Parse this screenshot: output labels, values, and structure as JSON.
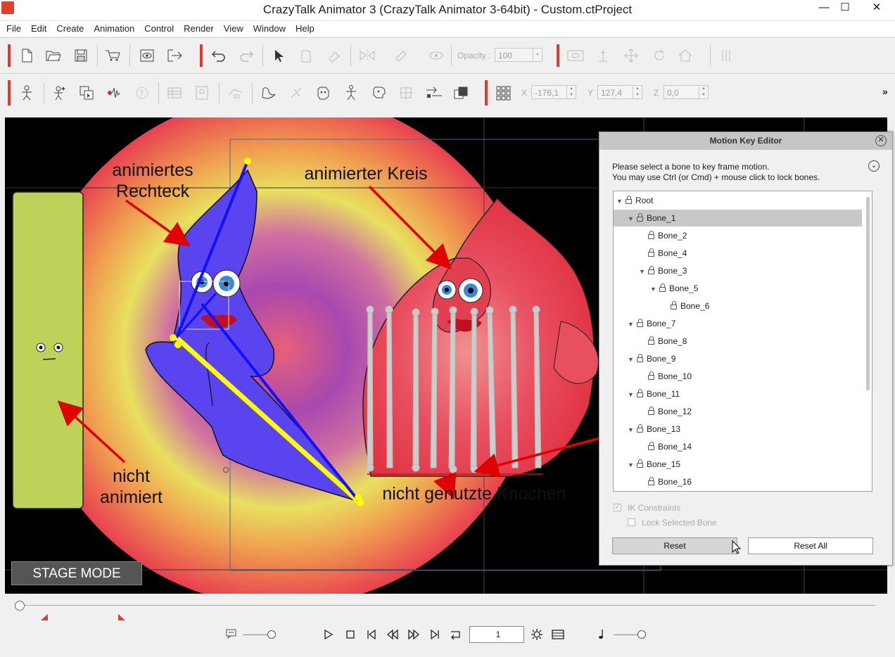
{
  "window": {
    "title": "CrazyTalk Animator 3  (CrazyTalk Animator 3-64bit) - Custom.ctProject",
    "minimize": "—",
    "maximize": "☐",
    "close": "✕"
  },
  "menu": [
    "File",
    "Edit",
    "Create",
    "Animation",
    "Control",
    "Render",
    "View",
    "Window",
    "Help"
  ],
  "toolbar1": {
    "opacity_label": "Opacity :",
    "opacity_value": "100"
  },
  "toolbar2": {
    "x_label": "X",
    "x_value": "-176,1",
    "y_label": "Y",
    "y_value": "127,4",
    "z_label": "Z",
    "z_value": "0,0",
    "more": "»"
  },
  "viewport": {
    "annotations": {
      "animiertes_rechteck": "animiertes\nRechteck",
      "animierter_kreis": "animierter Kreis",
      "nicht_animiert": "nicht\nanimiert",
      "nicht_genutzte_knochen": "nicht genutzte Knochen"
    },
    "stage_mode": "STAGE MODE"
  },
  "motion_key_editor": {
    "title": "Motion Key Editor",
    "instructions_line1": "Please select a bone to key frame motion.",
    "instructions_line2": "You may use Ctrl (or Cmd) + mouse click to lock bones.",
    "tree": [
      {
        "label": "Root",
        "depth": 0,
        "expanded": true,
        "selected": false
      },
      {
        "label": "Bone_1",
        "depth": 1,
        "expanded": true,
        "selected": true
      },
      {
        "label": "Bone_2",
        "depth": 2,
        "expanded": null,
        "selected": false
      },
      {
        "label": "Bone_4",
        "depth": 2,
        "expanded": null,
        "selected": false
      },
      {
        "label": "Bone_3",
        "depth": 2,
        "expanded": true,
        "selected": false
      },
      {
        "label": "Bone_5",
        "depth": 3,
        "expanded": true,
        "selected": false
      },
      {
        "label": "Bone_6",
        "depth": 4,
        "expanded": null,
        "selected": false
      },
      {
        "label": "Bone_7",
        "depth": 1,
        "expanded": true,
        "selected": false
      },
      {
        "label": "Bone_8",
        "depth": 2,
        "expanded": null,
        "selected": false
      },
      {
        "label": "Bone_9",
        "depth": 1,
        "expanded": true,
        "selected": false
      },
      {
        "label": "Bone_10",
        "depth": 2,
        "expanded": null,
        "selected": false
      },
      {
        "label": "Bone_11",
        "depth": 1,
        "expanded": true,
        "selected": false
      },
      {
        "label": "Bone_12",
        "depth": 2,
        "expanded": null,
        "selected": false
      },
      {
        "label": "Bone_13",
        "depth": 1,
        "expanded": true,
        "selected": false
      },
      {
        "label": "Bone_14",
        "depth": 2,
        "expanded": null,
        "selected": false
      },
      {
        "label": "Bone_15",
        "depth": 1,
        "expanded": true,
        "selected": false
      },
      {
        "label": "Bone_16",
        "depth": 2,
        "expanded": null,
        "selected": false
      }
    ],
    "ik_constraints_label": "IK Constraints",
    "ik_constraints_checked": true,
    "lock_selected_label": "Lock Selected Bone",
    "lock_selected_checked": false,
    "reset": "Reset",
    "reset_all": "Reset All"
  },
  "timeline": {
    "frame": "1"
  },
  "colors": {
    "accent_red": "#e03a2a",
    "character_blue": "#5a44f0",
    "rect_green": "#bed25a",
    "bone_yellow": "#ffff00"
  }
}
